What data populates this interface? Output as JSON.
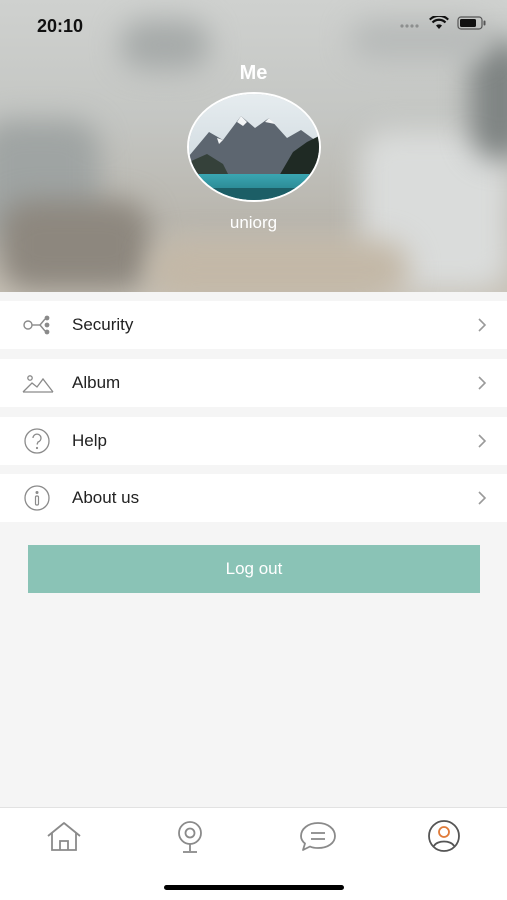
{
  "status_bar": {
    "time": "20:10"
  },
  "header": {
    "title": "Me",
    "username": "uniorg"
  },
  "menu": {
    "items": [
      {
        "label": "Security",
        "icon": "security-share-icon"
      },
      {
        "label": "Album",
        "icon": "album-image-icon"
      },
      {
        "label": "Help",
        "icon": "help-question-icon"
      },
      {
        "label": "About us",
        "icon": "info-icon"
      }
    ]
  },
  "logout_label": "Log out",
  "tabbar": {
    "tabs": [
      {
        "name": "home",
        "icon": "home-icon",
        "active": false
      },
      {
        "name": "camera",
        "icon": "camera-icon",
        "active": false
      },
      {
        "name": "messages",
        "icon": "chat-icon",
        "active": false
      },
      {
        "name": "me",
        "icon": "user-icon",
        "active": true
      }
    ]
  },
  "colors": {
    "accent": "#8ac3b6",
    "active_tab": "#e07b39",
    "icon_gray": "#8a8a8a"
  }
}
